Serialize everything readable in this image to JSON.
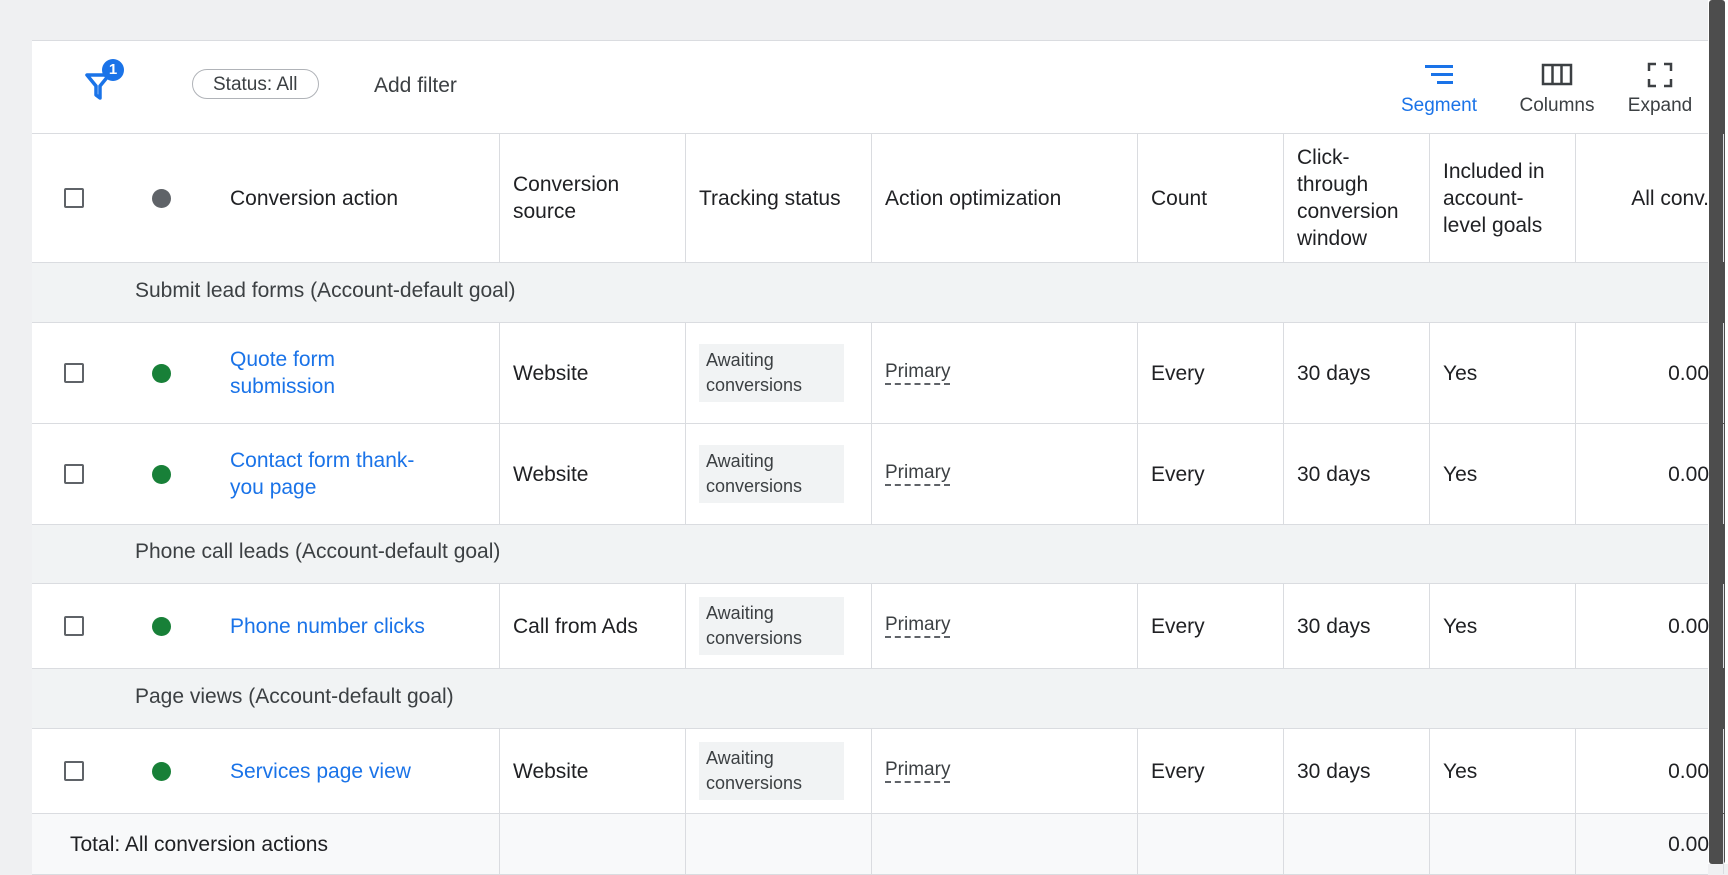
{
  "toolbar": {
    "filter_count": "1",
    "status_chip": "Status: All",
    "add_filter": "Add filter",
    "segment_label": "Segment",
    "columns_label": "Columns",
    "expand_label": "Expand"
  },
  "colors": {
    "accent": "#1a73e8",
    "status_enabled": "#188038",
    "status_header": "#5f6368"
  },
  "columns": {
    "action": "Conversion action",
    "source": "Conversion source",
    "tracking": "Tracking status",
    "optimization": "Action optimization",
    "count": "Count",
    "window": "Click-through conversion window",
    "included": "Included in account-level goals",
    "all_conv": "All conv."
  },
  "groups": [
    {
      "label": "Submit lead forms (Account-default goal)"
    },
    {
      "label": "Phone call leads (Account-default goal)"
    },
    {
      "label": "Page views (Account-default goal)"
    }
  ],
  "rows": [
    {
      "name": "Quote form submission",
      "source": "Website",
      "tracking": "Awaiting conversions",
      "optimization": "Primary",
      "count": "Every",
      "window": "30 days",
      "included": "Yes",
      "all_conv": "0.00"
    },
    {
      "name": "Contact form thank-you page",
      "source": "Website",
      "tracking": "Awaiting conversions",
      "optimization": "Primary",
      "count": "Every",
      "window": "30 days",
      "included": "Yes",
      "all_conv": "0.00"
    },
    {
      "name": "Phone number clicks",
      "source": "Call from Ads",
      "tracking": "Awaiting conversions",
      "optimization": "Primary",
      "count": "Every",
      "window": "30 days",
      "included": "Yes",
      "all_conv": "0.00"
    },
    {
      "name": "Services page view",
      "source": "Website",
      "tracking": "Awaiting conversions",
      "optimization": "Primary",
      "count": "Every",
      "window": "30 days",
      "included": "Yes",
      "all_conv": "0.00"
    }
  ],
  "total": {
    "label": "Total: All conversion actions",
    "all_conv": "0.00"
  }
}
